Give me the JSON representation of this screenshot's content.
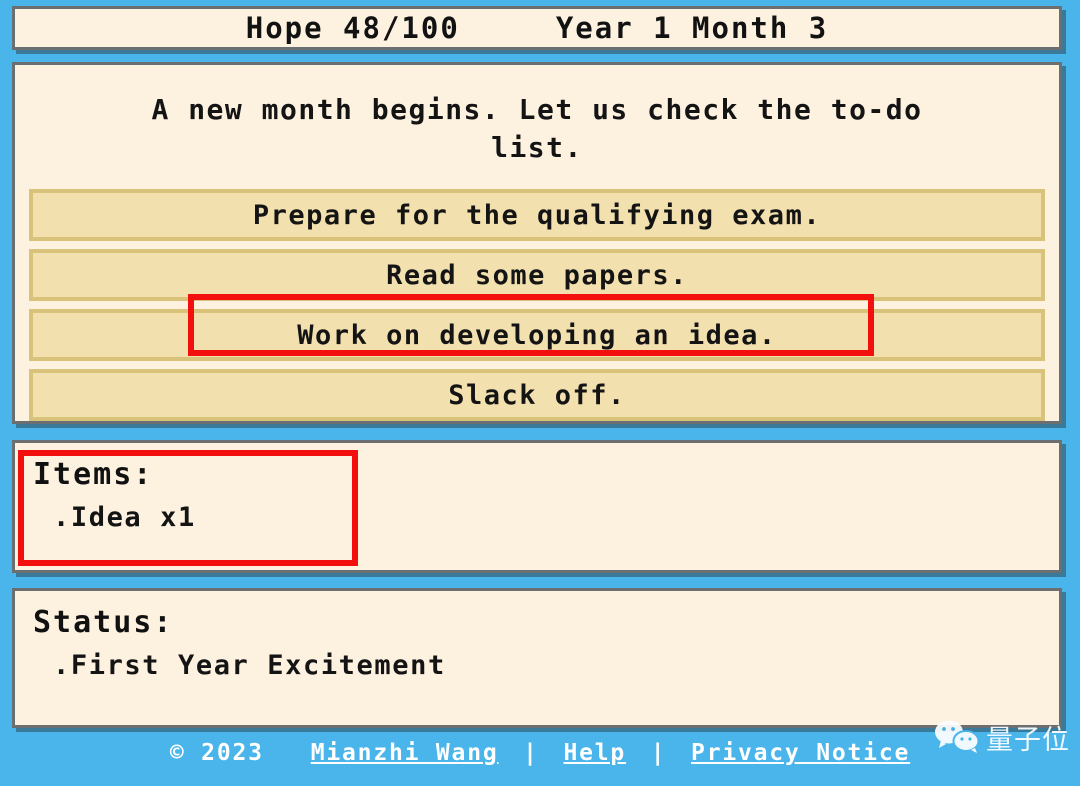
{
  "theme": {
    "background": "#49b5ea",
    "panel_bg": "#fdf1e0",
    "panel_border": "#6b6f72",
    "button_bg": "#f2e0ae",
    "button_border": "#d9c279",
    "annotation": "#f40f0f",
    "text": "#141414",
    "footer_text": "#ffffff"
  },
  "header": {
    "hope_label": "Hope 48/100",
    "hope_stat_name": "Hope",
    "hope_current": 48,
    "hope_max": 100,
    "date_label": "Year 1 Month 3",
    "year": 1,
    "month": 3
  },
  "main": {
    "story_text": "A new month begins. Let us check the to-do\nlist.",
    "choices": [
      {
        "label": "Prepare for the qualifying exam.",
        "highlighted": false
      },
      {
        "label": "Read some papers.",
        "highlighted": false
      },
      {
        "label": "Work on developing an idea.",
        "highlighted": true
      },
      {
        "label": "Slack off.",
        "highlighted": false
      }
    ]
  },
  "items": {
    "title": "Items:",
    "entries": [
      {
        "label": ".Idea x1",
        "name": "Idea",
        "count": 1
      }
    ]
  },
  "status": {
    "title": "Status:",
    "entries": [
      {
        "label": ".First Year Excitement",
        "name": "First Year Excitement"
      }
    ]
  },
  "footer": {
    "copyright": "© 2023",
    "author": "Mianzhi Wang",
    "separator": "|",
    "help_label": "Help",
    "privacy_label": "Privacy Notice"
  },
  "watermark": {
    "icon": "wechat-icon",
    "text": "量子位"
  }
}
